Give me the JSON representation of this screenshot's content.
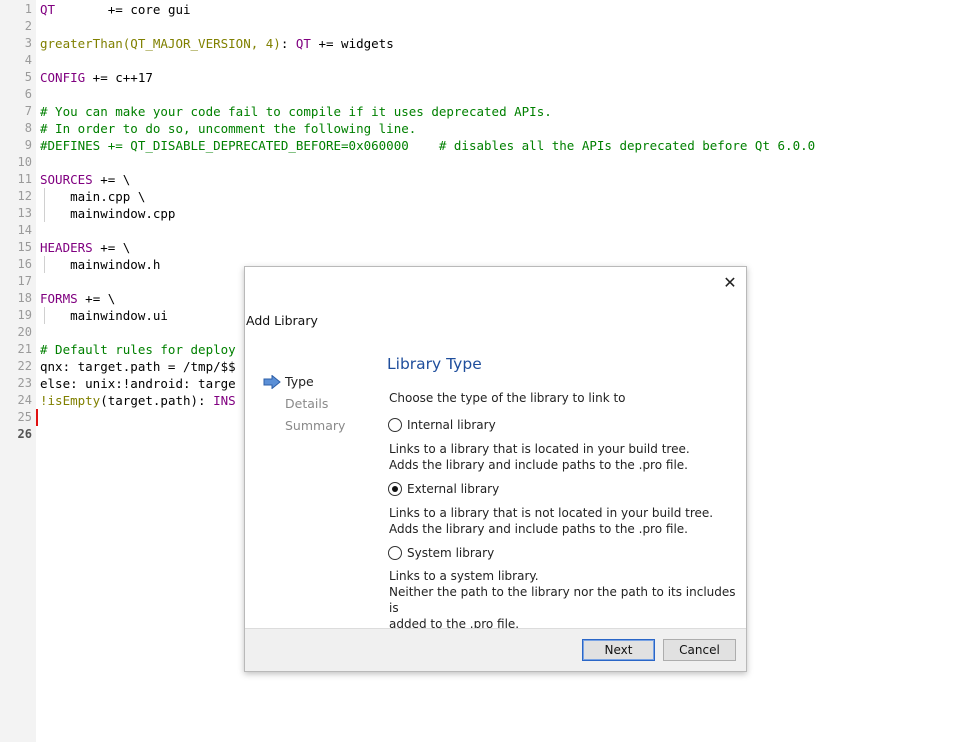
{
  "editor": {
    "lines": [
      {
        "n": "1",
        "parts": [
          {
            "t": "QT",
            "c": "c-key"
          },
          {
            "t": "       += core gui",
            "c": "c-def"
          }
        ]
      },
      {
        "n": "2",
        "parts": []
      },
      {
        "n": "3",
        "parts": [
          {
            "t": "greaterThan(QT_MAJOR_VERSION, 4)",
            "c": "c-fn"
          },
          {
            "t": ": ",
            "c": "c-def"
          },
          {
            "t": "QT",
            "c": "c-key"
          },
          {
            "t": " += widgets",
            "c": "c-def"
          }
        ]
      },
      {
        "n": "4",
        "parts": []
      },
      {
        "n": "5",
        "parts": [
          {
            "t": "CONFIG",
            "c": "c-key"
          },
          {
            "t": " += c++17",
            "c": "c-def"
          }
        ]
      },
      {
        "n": "6",
        "parts": []
      },
      {
        "n": "7",
        "parts": [
          {
            "t": "# You can make your code fail to compile if it uses deprecated APIs.",
            "c": "c-com"
          }
        ]
      },
      {
        "n": "8",
        "parts": [
          {
            "t": "# In order to do so, uncomment the following line.",
            "c": "c-com"
          }
        ]
      },
      {
        "n": "9",
        "parts": [
          {
            "t": "#DEFINES += QT_DISABLE_DEPRECATED_BEFORE=0x060000    # disables all the APIs deprecated before Qt 6.0.0",
            "c": "c-com"
          }
        ]
      },
      {
        "n": "10",
        "parts": []
      },
      {
        "n": "11",
        "parts": [
          {
            "t": "SOURCES",
            "c": "c-key"
          },
          {
            "t": " += \\",
            "c": "c-def"
          }
        ]
      },
      {
        "n": "12",
        "parts": [
          {
            "t": "    main.cpp \\",
            "c": "c-def"
          }
        ],
        "guide": true
      },
      {
        "n": "13",
        "parts": [
          {
            "t": "    mainwindow.cpp",
            "c": "c-def"
          }
        ],
        "guide": true
      },
      {
        "n": "14",
        "parts": []
      },
      {
        "n": "15",
        "parts": [
          {
            "t": "HEADERS",
            "c": "c-key"
          },
          {
            "t": " += \\",
            "c": "c-def"
          }
        ]
      },
      {
        "n": "16",
        "parts": [
          {
            "t": "    mainwindow.h",
            "c": "c-def"
          }
        ],
        "guide": true
      },
      {
        "n": "17",
        "parts": []
      },
      {
        "n": "18",
        "parts": [
          {
            "t": "FORMS",
            "c": "c-key"
          },
          {
            "t": " += \\",
            "c": "c-def"
          }
        ]
      },
      {
        "n": "19",
        "parts": [
          {
            "t": "    mainwindow.ui",
            "c": "c-def"
          }
        ],
        "guide": true
      },
      {
        "n": "20",
        "parts": []
      },
      {
        "n": "21",
        "parts": [
          {
            "t": "# Default rules for deploy",
            "c": "c-com"
          }
        ]
      },
      {
        "n": "22",
        "parts": [
          {
            "t": "qnx: target.path = /tmp/$$",
            "c": "c-def"
          }
        ]
      },
      {
        "n": "23",
        "parts": [
          {
            "t": "else: unix:!android: targe",
            "c": "c-def"
          }
        ]
      },
      {
        "n": "24",
        "parts": [
          {
            "t": "!isEmpty",
            "c": "c-fn"
          },
          {
            "t": "(target.path): ",
            "c": "c-def"
          },
          {
            "t": "INS",
            "c": "c-key"
          }
        ]
      },
      {
        "n": "25",
        "parts": []
      },
      {
        "n": "26",
        "parts": [],
        "current": true
      }
    ]
  },
  "dialog": {
    "title": "Add Library",
    "close_glyph": "✕",
    "steps": [
      "Type",
      "Details",
      "Summary"
    ],
    "page_title": "Library Type",
    "prompt": "Choose the type of the library to link to",
    "options": [
      {
        "label": "Internal library",
        "checked": false,
        "desc": [
          "Links to a library that is located in your build tree.",
          "Adds the library and include paths to the .pro file."
        ]
      },
      {
        "label": "External library",
        "checked": true,
        "desc": [
          "Links to a library that is not located in your build tree.",
          "Adds the library and include paths to the .pro file."
        ]
      },
      {
        "label": "System library",
        "checked": false,
        "desc": [
          "Links to a system library.",
          "Neither the path to the library nor the path to its includes is",
          "added to the .pro file."
        ]
      }
    ],
    "next_label": "Next",
    "cancel_label": "Cancel"
  }
}
